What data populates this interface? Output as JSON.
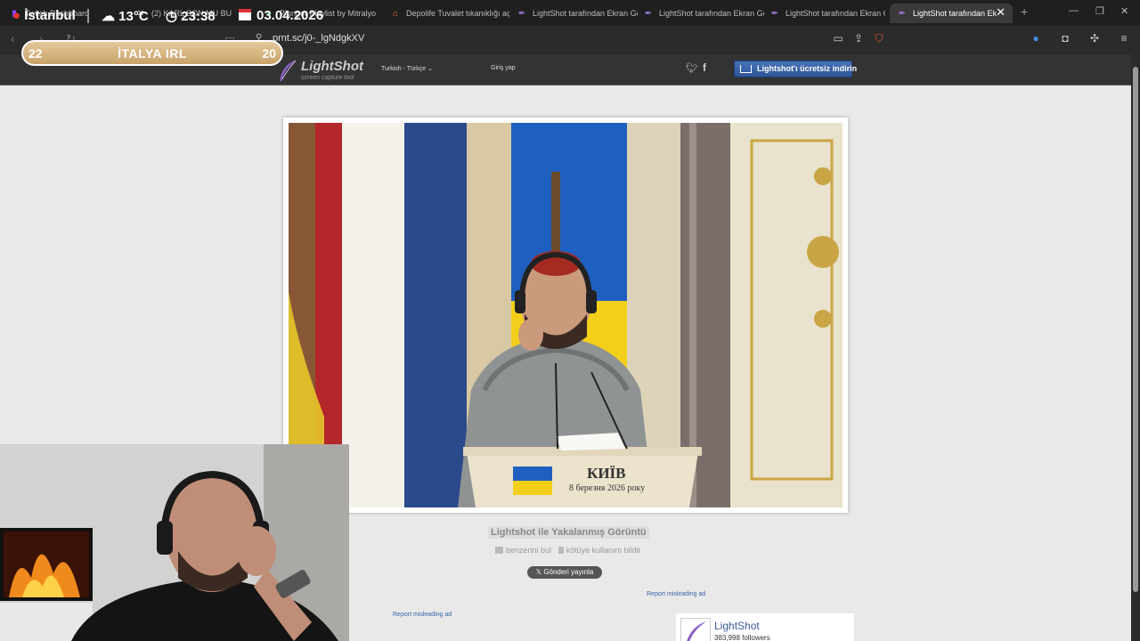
{
  "browser": {
    "tabs": [
      {
        "label": "Twitch Dashboard",
        "icon": "twitch-icon"
      },
      {
        "label": "(2) KARL SON MU BU",
        "icon": "x-icon"
      },
      {
        "label": "Plunger Playlist by Mitralyo",
        "icon": "spotify-icon"
      },
      {
        "label": "Depolife Tuvalet tıkanıklığı açıcı",
        "icon": "home-icon"
      },
      {
        "label": "LightShot tarafından Ekran Görü",
        "icon": "feather-icon"
      },
      {
        "label": "LightShot tarafından Ekran Görü",
        "icon": "feather-icon"
      },
      {
        "label": "LightShot tarafından Ekran Görü",
        "icon": "feather-icon"
      },
      {
        "label": "LightShot tarafından Ek",
        "icon": "feather-icon",
        "active": true
      }
    ],
    "url": "prnt.sc/j0-_lgNdgkXV"
  },
  "overlay": {
    "city": "İstanbul",
    "temperature": "13°C",
    "time": "23:38",
    "date": "03.04.2026",
    "score_left": "22",
    "score_name": "İTALYA IRL",
    "score_right": "20"
  },
  "lightshot": {
    "logo_name": "LightShot",
    "logo_tagline": "screen capture tool",
    "language": "Turkish - Türkçe",
    "login": "Giriş yap",
    "download_button": "Lightshot'ı ücretsiz indirin",
    "caption": "Lightshot ile Yakalanmış Görüntü",
    "find_similar": "benzerini bul",
    "report_abuse": "kötüye kullanım bildir",
    "tweet_button": "Gönderi yayınla",
    "report_ad_1": "Report misleading ad",
    "report_ad_2": "Report misleading ad",
    "fb_name": "LightShot",
    "fb_followers": "383,998 followers"
  },
  "screenshot": {
    "podium_title": "КИЇВ",
    "podium_date": "8 березня 2026 року"
  },
  "colors": {
    "accent_blue": "#2e5598",
    "ukraine_blue": "#1f5fbf",
    "ukraine_yellow": "#f3cf1b",
    "netherlands_red": "#b3262a"
  }
}
